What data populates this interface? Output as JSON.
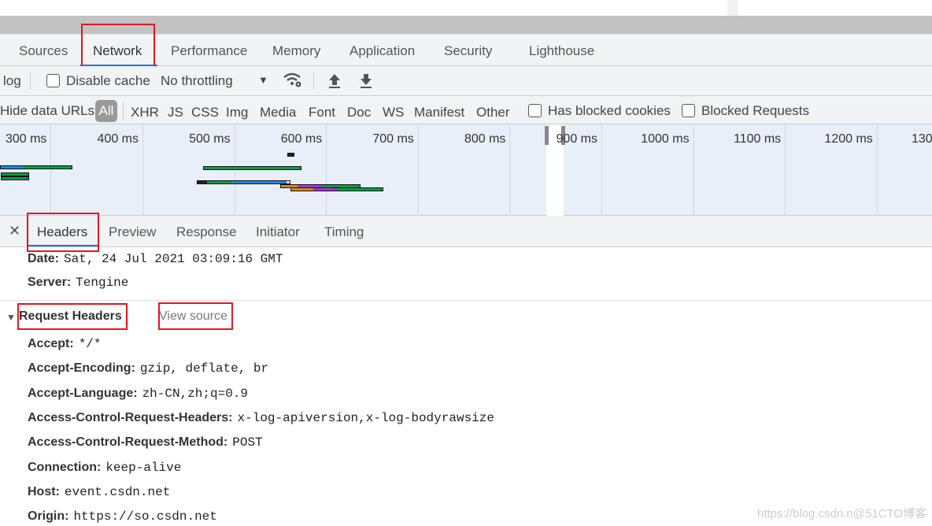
{
  "main_tabs": [
    {
      "label": "Sources"
    },
    {
      "label": "Network"
    },
    {
      "label": "Performance"
    },
    {
      "label": "Memory"
    },
    {
      "label": "Application"
    },
    {
      "label": "Security"
    },
    {
      "label": "Lighthouse"
    }
  ],
  "active_tab": "Network",
  "toolbar": {
    "preserve_log_fragment": "log",
    "disable_cache_label": "Disable cache",
    "disable_cache_checked": false,
    "throttling_value": "No throttling",
    "icons": [
      "dropdown-arrow-icon",
      "wifi-settings-icon",
      "upload-icon",
      "download-icon"
    ]
  },
  "filters": {
    "hide_data_urls_fragment": "Hide data URLs",
    "types": [
      "All",
      "XHR",
      "JS",
      "CSS",
      "Img",
      "Media",
      "Font",
      "Doc",
      "WS",
      "Manifest",
      "Other"
    ],
    "selected": "All",
    "has_blocked_cookies": "Has blocked cookies",
    "blocked_requests": "Blocked Requests"
  },
  "timeline": {
    "tick_labels": [
      "300 ms",
      "400 ms",
      "500 ms",
      "600 ms",
      "700 ms",
      "800 ms",
      "900 ms",
      "1000 ms",
      "1100 ms",
      "1200 ms",
      "130"
    ],
    "colors": {
      "blue": "#1e88e5",
      "green": "#0a9d4a",
      "orange": "#d88a14",
      "purple": "#a43ad8",
      "black": "#222222"
    },
    "requests": [
      {
        "segments": [
          [
            "blue",
            247,
            272
          ],
          [
            "green",
            272,
            326
          ]
        ],
        "lane": 0
      },
      {
        "segments": [
          [
            "green",
            248,
            279
          ]
        ],
        "lane": 1
      },
      {
        "segments": [
          [
            "green",
            248,
            279
          ]
        ],
        "lane": 2
      },
      {
        "segments": [
          [
            "black",
            560,
            568
          ]
        ],
        "lane": 3
      },
      {
        "segments": [
          [
            "green",
            469,
            511
          ],
          [
            "green",
            511,
            576
          ]
        ],
        "lane": 4
      },
      {
        "segments": [
          [
            "black",
            462,
            472
          ],
          [
            "green",
            472,
            500
          ],
          [
            "blue",
            504,
            564
          ]
        ],
        "lane": 5
      },
      {
        "segments": [
          [
            "orange",
            553,
            571
          ],
          [
            "purple",
            571,
            597
          ],
          [
            "green",
            597,
            640
          ]
        ],
        "lane": 6
      },
      {
        "segments": [
          [
            "orange",
            564,
            588
          ],
          [
            "purple",
            588,
            614
          ],
          [
            "green",
            614,
            665
          ]
        ],
        "lane": 7
      }
    ]
  },
  "detail_tabs": [
    {
      "label": "Headers"
    },
    {
      "label": "Preview"
    },
    {
      "label": "Response"
    },
    {
      "label": "Initiator"
    },
    {
      "label": "Timing"
    }
  ],
  "active_detail_tab": "Headers",
  "response_headers": [
    {
      "key": "Date:",
      "value": "Sat, 24 Jul 2021 03:09:16 GMT"
    },
    {
      "key": "Server:",
      "value": "Tengine"
    }
  ],
  "request_headers_section": {
    "title": "Request Headers",
    "view_source": "View source"
  },
  "request_headers": [
    {
      "key": "Accept:",
      "value": "*/*"
    },
    {
      "key": "Accept-Encoding:",
      "value": "gzip, deflate, br"
    },
    {
      "key": "Accept-Language:",
      "value": "zh-CN,zh;q=0.9"
    },
    {
      "key": "Access-Control-Request-Headers:",
      "value": "x-log-apiversion,x-log-bodyrawsize"
    },
    {
      "key": "Access-Control-Request-Method:",
      "value": "POST"
    },
    {
      "key": "Connection:",
      "value": "keep-alive"
    },
    {
      "key": "Host:",
      "value": "event.csdn.net"
    },
    {
      "key": "Origin:",
      "value": "https://so.csdn.net"
    }
  ],
  "watermark": "https://blog.csdn.n@51CTO博客",
  "accent_color": "#1a73e8",
  "annotation_color": "#e8141c"
}
